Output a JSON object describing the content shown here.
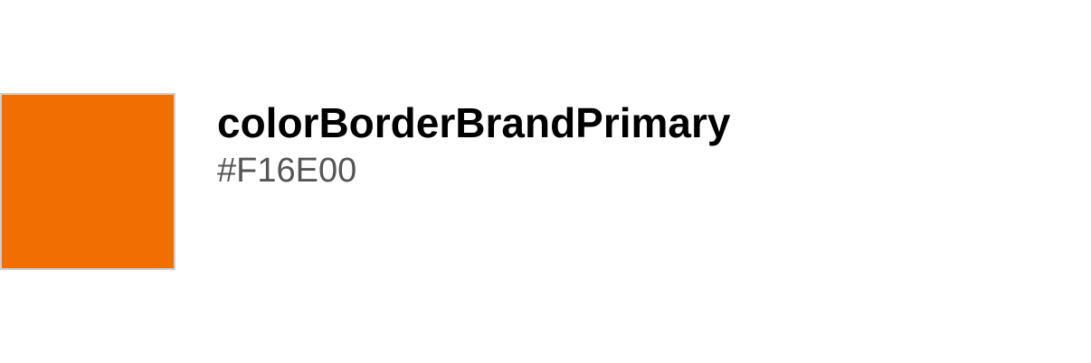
{
  "token": {
    "name": "colorBorderBrandPrimary",
    "value": "#F16E00"
  },
  "colors": {
    "swatch": "#F16E00",
    "swatch_border": "#cfcfcf"
  }
}
